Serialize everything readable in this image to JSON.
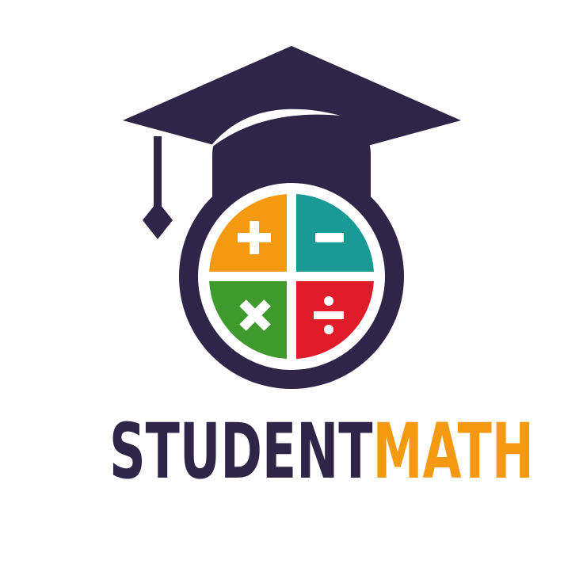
{
  "brand": {
    "name_part1": "STUDENT",
    "name_part2": "MATH"
  },
  "colors": {
    "navy": "#2e2548",
    "orange": "#f59a10",
    "teal": "#1a9a95",
    "green": "#3e9a2c",
    "red": "#e01c2a",
    "white": "#ffffff"
  },
  "icons": {
    "cap": "graduation-cap-icon",
    "plus": "plus-icon",
    "minus": "minus-icon",
    "times": "multiply-icon",
    "divide": "divide-icon"
  }
}
